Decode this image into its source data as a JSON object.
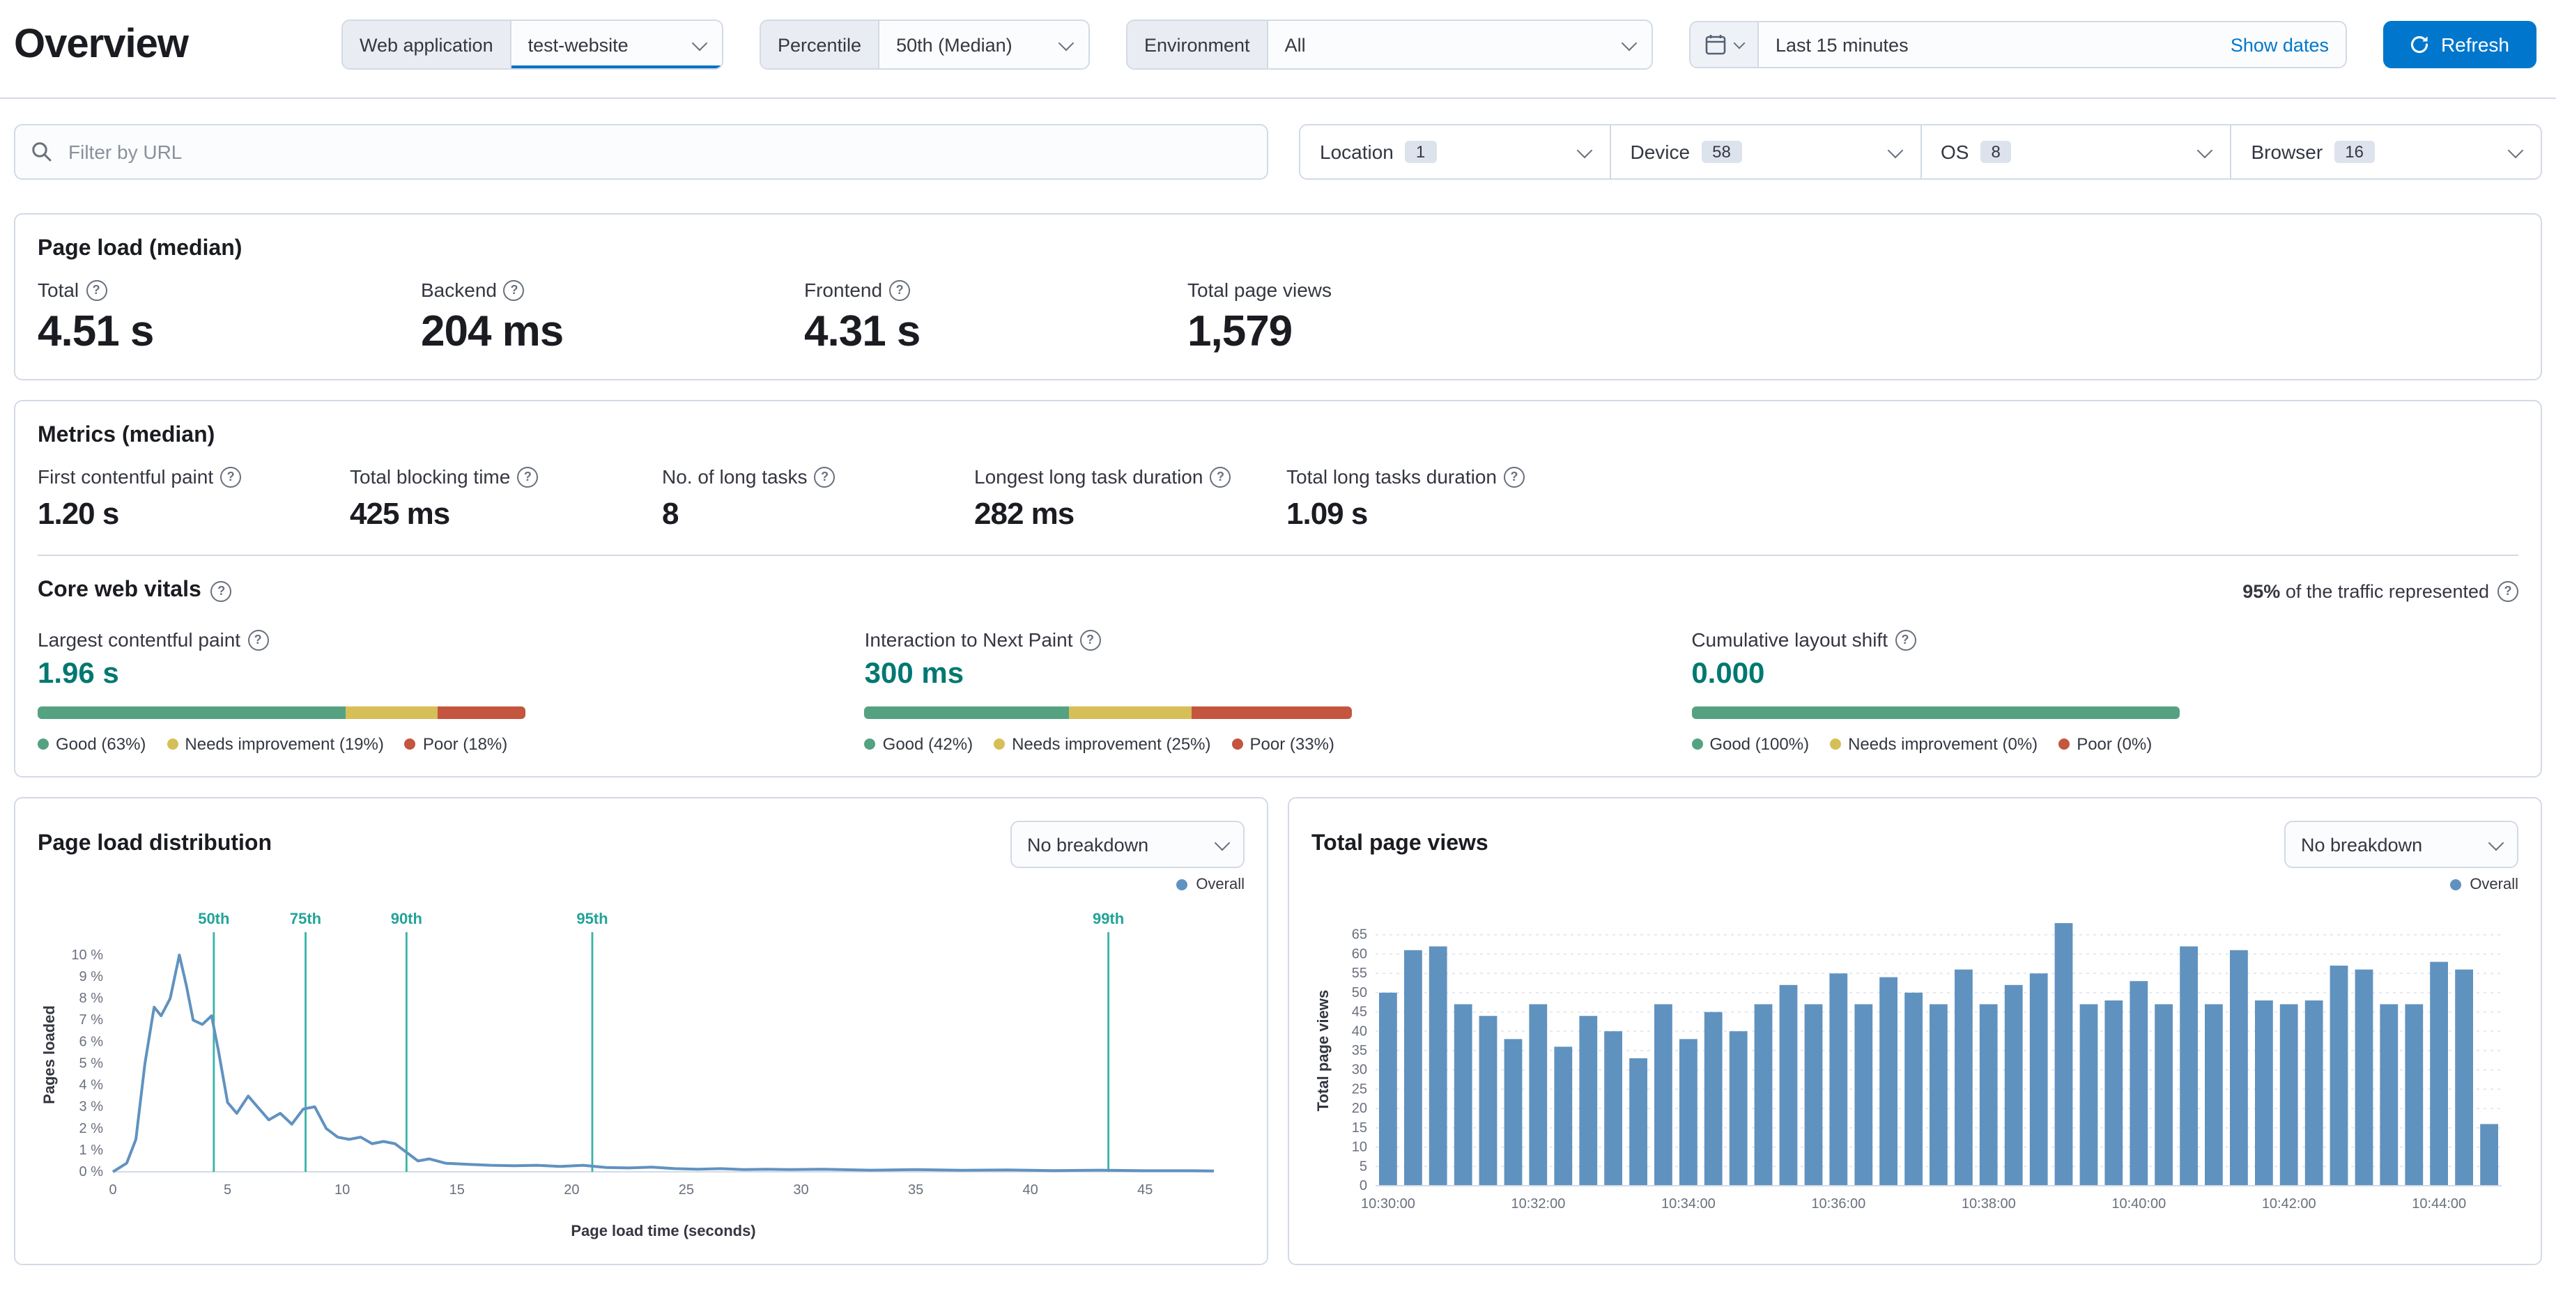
{
  "page": {
    "title": "Overview"
  },
  "toolbar": {
    "web_application": {
      "label": "Web application",
      "value": "test-website"
    },
    "percentile": {
      "label": "Percentile",
      "value": "50th (Median)"
    },
    "environment": {
      "label": "Environment",
      "value": "All"
    },
    "time_range": {
      "value": "Last 15 minutes",
      "show_dates_label": "Show dates"
    },
    "refresh_label": "Refresh"
  },
  "filters": {
    "url_filter_placeholder": "Filter by URL",
    "groups": [
      {
        "label": "Location",
        "count": 1
      },
      {
        "label": "Device",
        "count": 58
      },
      {
        "label": "OS",
        "count": 8
      },
      {
        "label": "Browser",
        "count": 16
      }
    ]
  },
  "page_load_median": {
    "title": "Page load (median)",
    "stats": [
      {
        "label": "Total",
        "value": "4.51 s",
        "info": true
      },
      {
        "label": "Backend",
        "value": "204 ms",
        "info": true
      },
      {
        "label": "Frontend",
        "value": "4.31 s",
        "info": true
      },
      {
        "label": "Total page views",
        "value": "1,579",
        "info": false
      }
    ]
  },
  "metrics_median": {
    "title": "Metrics (median)",
    "stats": [
      {
        "label": "First contentful paint",
        "value": "1.20 s"
      },
      {
        "label": "Total blocking time",
        "value": "425 ms"
      },
      {
        "label": "No. of long tasks",
        "value": "8"
      },
      {
        "label": "Longest long task duration",
        "value": "282 ms"
      },
      {
        "label": "Total long tasks duration",
        "value": "1.09 s"
      }
    ]
  },
  "core_web_vitals": {
    "title": "Core web vitals",
    "traffic_note_strong": "95%",
    "traffic_note_rest": " of the traffic represented",
    "colors": {
      "good": "#54a282",
      "needs_improvement": "#d6bf57",
      "poor": "#c4553f"
    },
    "items": [
      {
        "label": "Largest contentful paint",
        "value": "1.96 s",
        "good": 63,
        "needs_improvement": 19,
        "poor": 18,
        "legend": [
          "Good (63%)",
          "Needs improvement (19%)",
          "Poor (18%)"
        ]
      },
      {
        "label": "Interaction to Next Paint",
        "value": "300 ms",
        "good": 42,
        "needs_improvement": 25,
        "poor": 33,
        "legend": [
          "Good (42%)",
          "Needs improvement (25%)",
          "Poor (33%)"
        ]
      },
      {
        "label": "Cumulative layout shift",
        "value": "0.000",
        "good": 100,
        "needs_improvement": 0,
        "poor": 0,
        "legend": [
          "Good (100%)",
          "Needs improvement (0%)",
          "Poor (0%)"
        ]
      }
    ]
  },
  "distribution_panel": {
    "title": "Page load distribution",
    "breakdown_value": "No breakdown",
    "legend_label": "Overall"
  },
  "pageviews_panel": {
    "title": "Total page views",
    "breakdown_value": "No breakdown",
    "legend_label": "Overall"
  },
  "chart_data": [
    {
      "type": "line",
      "title": "Page load distribution",
      "xlabel": "Page load time (seconds)",
      "ylabel": "Pages loaded",
      "xlim": [
        0,
        48
      ],
      "ylim": [
        0,
        10.8
      ],
      "x_ticks": [
        0,
        5,
        10,
        15,
        20,
        25,
        30,
        35,
        40,
        45
      ],
      "y_ticks": [
        0,
        1,
        2,
        3,
        4,
        5,
        6,
        7,
        8,
        9,
        10
      ],
      "y_tick_suffix": " %",
      "grid": false,
      "legend_position": "top-right",
      "percentile_markers": [
        {
          "label": "50th",
          "x": 4.4
        },
        {
          "label": "75th",
          "x": 8.4
        },
        {
          "label": "90th",
          "x": 12.8
        },
        {
          "label": "95th",
          "x": 20.9
        },
        {
          "label": "99th",
          "x": 43.4
        }
      ],
      "series": [
        {
          "name": "Overall",
          "color": "#6092C0",
          "points": [
            [
              0,
              0
            ],
            [
              0.6,
              0.4
            ],
            [
              1.0,
              1.5
            ],
            [
              1.4,
              5.0
            ],
            [
              1.8,
              7.6
            ],
            [
              2.1,
              7.2
            ],
            [
              2.5,
              8.0
            ],
            [
              2.9,
              10.0
            ],
            [
              3.2,
              8.6
            ],
            [
              3.5,
              7.0
            ],
            [
              3.9,
              6.8
            ],
            [
              4.3,
              7.2
            ],
            [
              4.6,
              5.6
            ],
            [
              5.0,
              3.2
            ],
            [
              5.4,
              2.7
            ],
            [
              5.9,
              3.5
            ],
            [
              6.3,
              3.0
            ],
            [
              6.8,
              2.4
            ],
            [
              7.3,
              2.7
            ],
            [
              7.8,
              2.2
            ],
            [
              8.3,
              2.9
            ],
            [
              8.8,
              3.0
            ],
            [
              9.3,
              2.0
            ],
            [
              9.8,
              1.6
            ],
            [
              10.3,
              1.5
            ],
            [
              10.8,
              1.6
            ],
            [
              11.3,
              1.3
            ],
            [
              11.8,
              1.4
            ],
            [
              12.3,
              1.3
            ],
            [
              12.8,
              0.9
            ],
            [
              13.3,
              0.5
            ],
            [
              13.8,
              0.6
            ],
            [
              14.5,
              0.4
            ],
            [
              15.5,
              0.35
            ],
            [
              16.5,
              0.3
            ],
            [
              17.5,
              0.28
            ],
            [
              18.5,
              0.3
            ],
            [
              19.5,
              0.25
            ],
            [
              20.5,
              0.3
            ],
            [
              21.5,
              0.2
            ],
            [
              22.5,
              0.18
            ],
            [
              23.5,
              0.22
            ],
            [
              24.5,
              0.15
            ],
            [
              25.5,
              0.12
            ],
            [
              26.5,
              0.15
            ],
            [
              27.5,
              0.1
            ],
            [
              28.5,
              0.12
            ],
            [
              29.5,
              0.1
            ],
            [
              31,
              0.12
            ],
            [
              33,
              0.08
            ],
            [
              35,
              0.1
            ],
            [
              37,
              0.07
            ],
            [
              39,
              0.09
            ],
            [
              41,
              0.06
            ],
            [
              43,
              0.08
            ],
            [
              45,
              0.05
            ],
            [
              47,
              0.05
            ],
            [
              48,
              0.04
            ]
          ]
        }
      ]
    },
    {
      "type": "bar",
      "title": "Total page views",
      "ylabel": "Total page views",
      "ylim": [
        0,
        70
      ],
      "y_ticks": [
        0,
        5,
        10,
        15,
        20,
        25,
        30,
        35,
        40,
        45,
        50,
        55,
        60,
        65
      ],
      "grid": true,
      "legend_position": "top-right",
      "bar_color": "#6092C0",
      "series_name": "Overall",
      "x_labels": [
        "10:30:00",
        "10:32:00",
        "10:34:00",
        "10:36:00",
        "10:38:00",
        "10:40:00",
        "10:42:00",
        "10:44:00"
      ],
      "x_tick_every": 6,
      "values": [
        50,
        61,
        62,
        47,
        44,
        38,
        47,
        36,
        44,
        40,
        33,
        47,
        38,
        45,
        40,
        47,
        52,
        47,
        55,
        47,
        54,
        50,
        47,
        56,
        47,
        52,
        55,
        68,
        47,
        48,
        53,
        47,
        62,
        47,
        61,
        48,
        47,
        48,
        57,
        56,
        47,
        47,
        58,
        56,
        16
      ]
    }
  ]
}
